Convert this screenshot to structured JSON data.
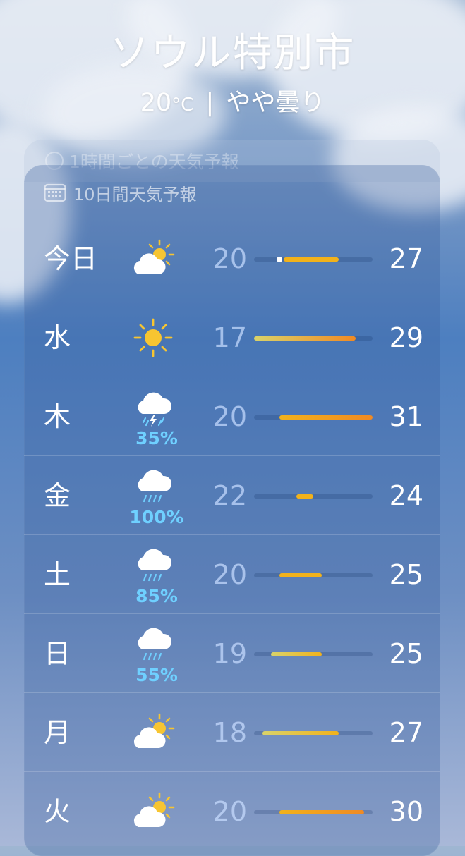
{
  "header": {
    "city": "ソウル特別市",
    "current_temp": "20",
    "unit": "°C",
    "separator": "|",
    "condition": "やや曇り"
  },
  "hourly": {
    "label": "1時間ごとの天気予報"
  },
  "forecast": {
    "label": "10日間天気予報",
    "icon": "calendar-icon",
    "range_min": 17,
    "range_max": 31,
    "current_marker": 20,
    "days": [
      {
        "day": "今日",
        "icon": "partly-cloudy-icon",
        "precip": "",
        "low": "20",
        "high": "27"
      },
      {
        "day": "水",
        "icon": "sun-icon",
        "precip": "",
        "low": "17",
        "high": "29"
      },
      {
        "day": "木",
        "icon": "thunderstorm-icon",
        "precip": "35%",
        "low": "20",
        "high": "31"
      },
      {
        "day": "金",
        "icon": "rain-icon",
        "precip": "100%",
        "low": "22",
        "high": "24"
      },
      {
        "day": "土",
        "icon": "rain-icon",
        "precip": "85%",
        "low": "20",
        "high": "25"
      },
      {
        "day": "日",
        "icon": "rain-icon",
        "precip": "55%",
        "low": "19",
        "high": "25"
      },
      {
        "day": "月",
        "icon": "partly-cloudy-icon",
        "precip": "",
        "low": "18",
        "high": "27"
      },
      {
        "day": "火",
        "icon": "partly-cloudy-icon",
        "precip": "",
        "low": "20",
        "high": "30"
      }
    ]
  },
  "colors": {
    "precip": "#6fd0ff",
    "bar_cool": "#d9d36a",
    "bar_warm": "#f2b21b",
    "bar_hot": "#f08a24"
  }
}
